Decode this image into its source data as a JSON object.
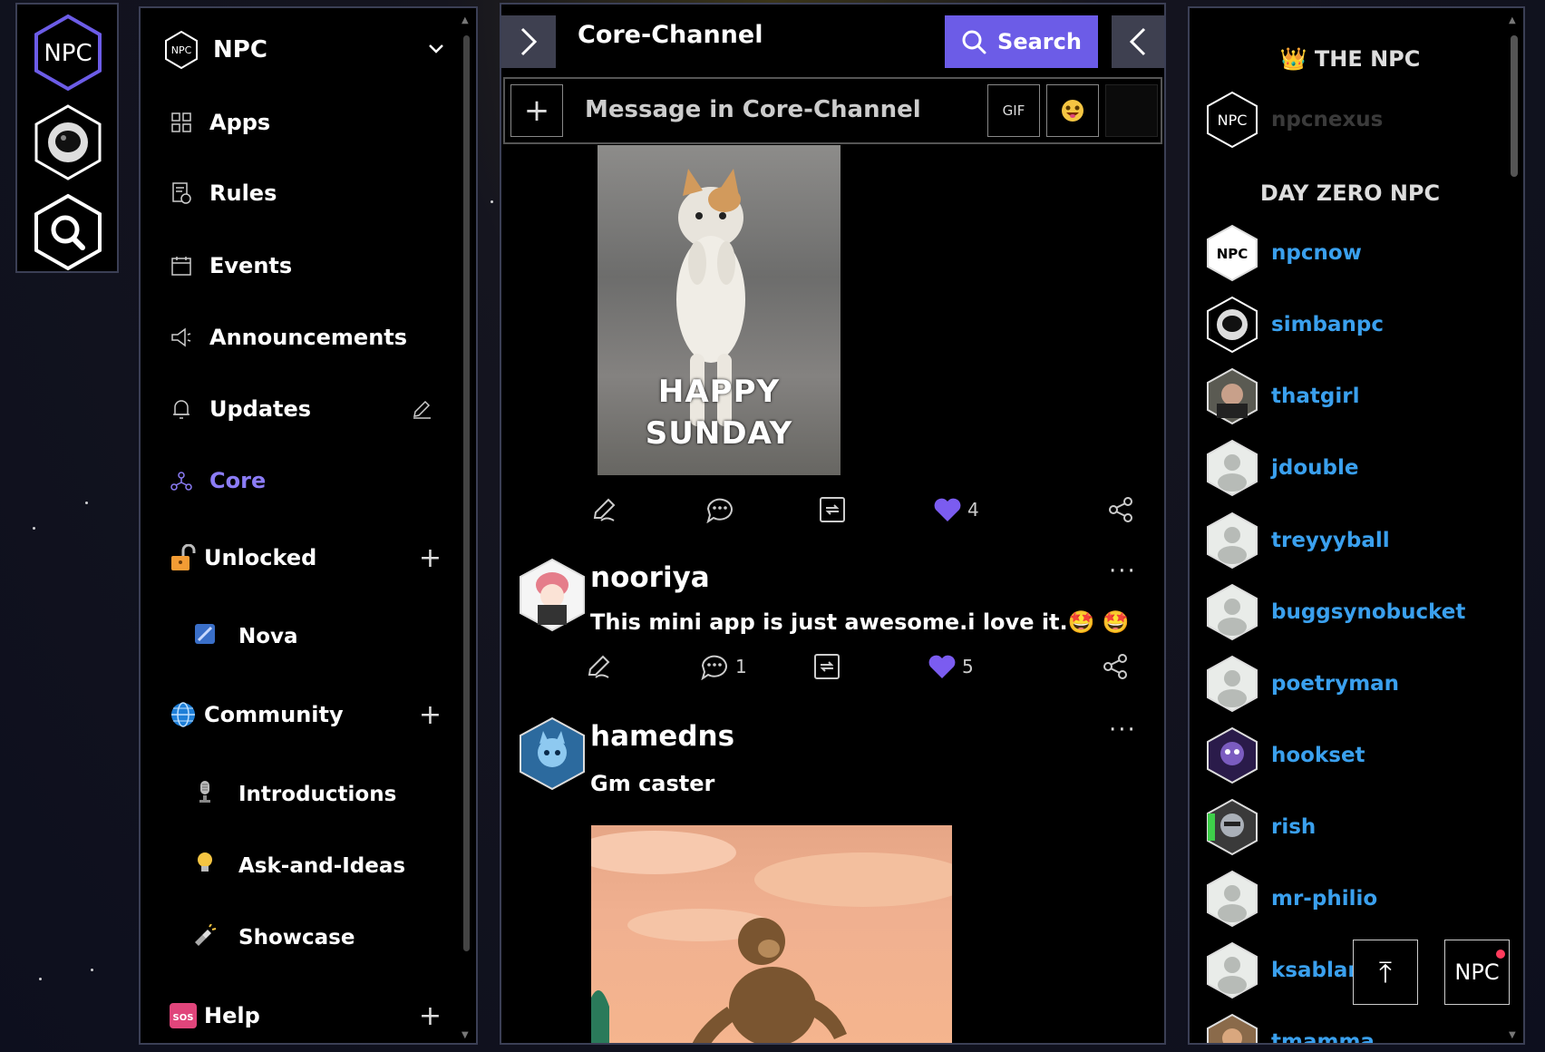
{
  "rail": {
    "items": [
      {
        "name": "npc-home-icon",
        "label": "NPC"
      },
      {
        "name": "astronaut-icon"
      },
      {
        "name": "search-icon"
      }
    ]
  },
  "sidebar": {
    "server_name": "NPC",
    "server_logo": "NPC",
    "nav": [
      {
        "label": "Apps",
        "icon": "apps-grid-icon"
      },
      {
        "label": "Rules",
        "icon": "rules-doc-icon"
      },
      {
        "label": "Events",
        "icon": "calendar-icon"
      },
      {
        "label": "Announcements",
        "icon": "megaphone-icon"
      },
      {
        "label": "Updates",
        "icon": "bell-icon"
      },
      {
        "label": "Core",
        "icon": "network-icon",
        "active": true
      }
    ],
    "sections": [
      {
        "label": "Unlocked",
        "icon": "unlocked-icon",
        "channels": [
          {
            "label": "Nova",
            "icon": "nova-icon"
          }
        ]
      },
      {
        "label": "Community",
        "icon": "globe-icon",
        "channels": [
          {
            "label": "Introductions",
            "icon": "microphone-icon"
          },
          {
            "label": "Ask-and-Ideas",
            "icon": "lightbulb-icon"
          },
          {
            "label": "Showcase",
            "icon": "flashlight-icon"
          }
        ]
      },
      {
        "label": "Help",
        "icon": "sos-icon",
        "channels": []
      }
    ],
    "sos_badge": "SOS",
    "add_label": "+"
  },
  "header": {
    "channel_title": "Core-Channel",
    "search_label": "Search"
  },
  "composer": {
    "placeholder": "Message in Core-Channel",
    "plus_label": "+",
    "gif_label": "GIF"
  },
  "feed": {
    "first_post": {
      "image_caption_line1": "HAPPY",
      "image_caption_line2": "SUNDAY",
      "likes": "4"
    },
    "posts": [
      {
        "author": "nooriya",
        "text": "This mini app is just awesome.i love it.🤩 🤩",
        "comments": "1",
        "likes": "5",
        "more": "···"
      },
      {
        "author": "hamedns",
        "text": "Gm caster",
        "more": "···"
      }
    ]
  },
  "members": {
    "group1_title": "THE NPC",
    "group1_icon": "👑",
    "group1": [
      {
        "name": "npcnexus",
        "dim": true,
        "avatar": "npc-logo"
      }
    ],
    "group2_title": "DAY ZERO NPC",
    "group2": [
      {
        "name": "npcnow",
        "avatar": "npcnow-logo"
      },
      {
        "name": "simbanpc",
        "avatar": "astronaut"
      },
      {
        "name": "thatgirl",
        "avatar": "photo"
      },
      {
        "name": "jdouble",
        "avatar": "default"
      },
      {
        "name": "treyyyball",
        "avatar": "default"
      },
      {
        "name": "buggsynobucket",
        "avatar": "default"
      },
      {
        "name": "poetryman",
        "avatar": "default"
      },
      {
        "name": "hookset",
        "avatar": "purple"
      },
      {
        "name": "rish",
        "avatar": "robot"
      },
      {
        "name": "mr-philio",
        "avatar": "default"
      },
      {
        "name": "ksablan",
        "avatar": "default"
      },
      {
        "name": "tmamma",
        "avatar": "photo"
      }
    ]
  },
  "floating": {
    "scroll_top_label": "⤒",
    "npc_label": "NPC"
  },
  "colors": {
    "accent": "#6c5ce7",
    "link": "#3aa0ee",
    "active": "#8b7cf6",
    "like": "#7b5cf0"
  }
}
